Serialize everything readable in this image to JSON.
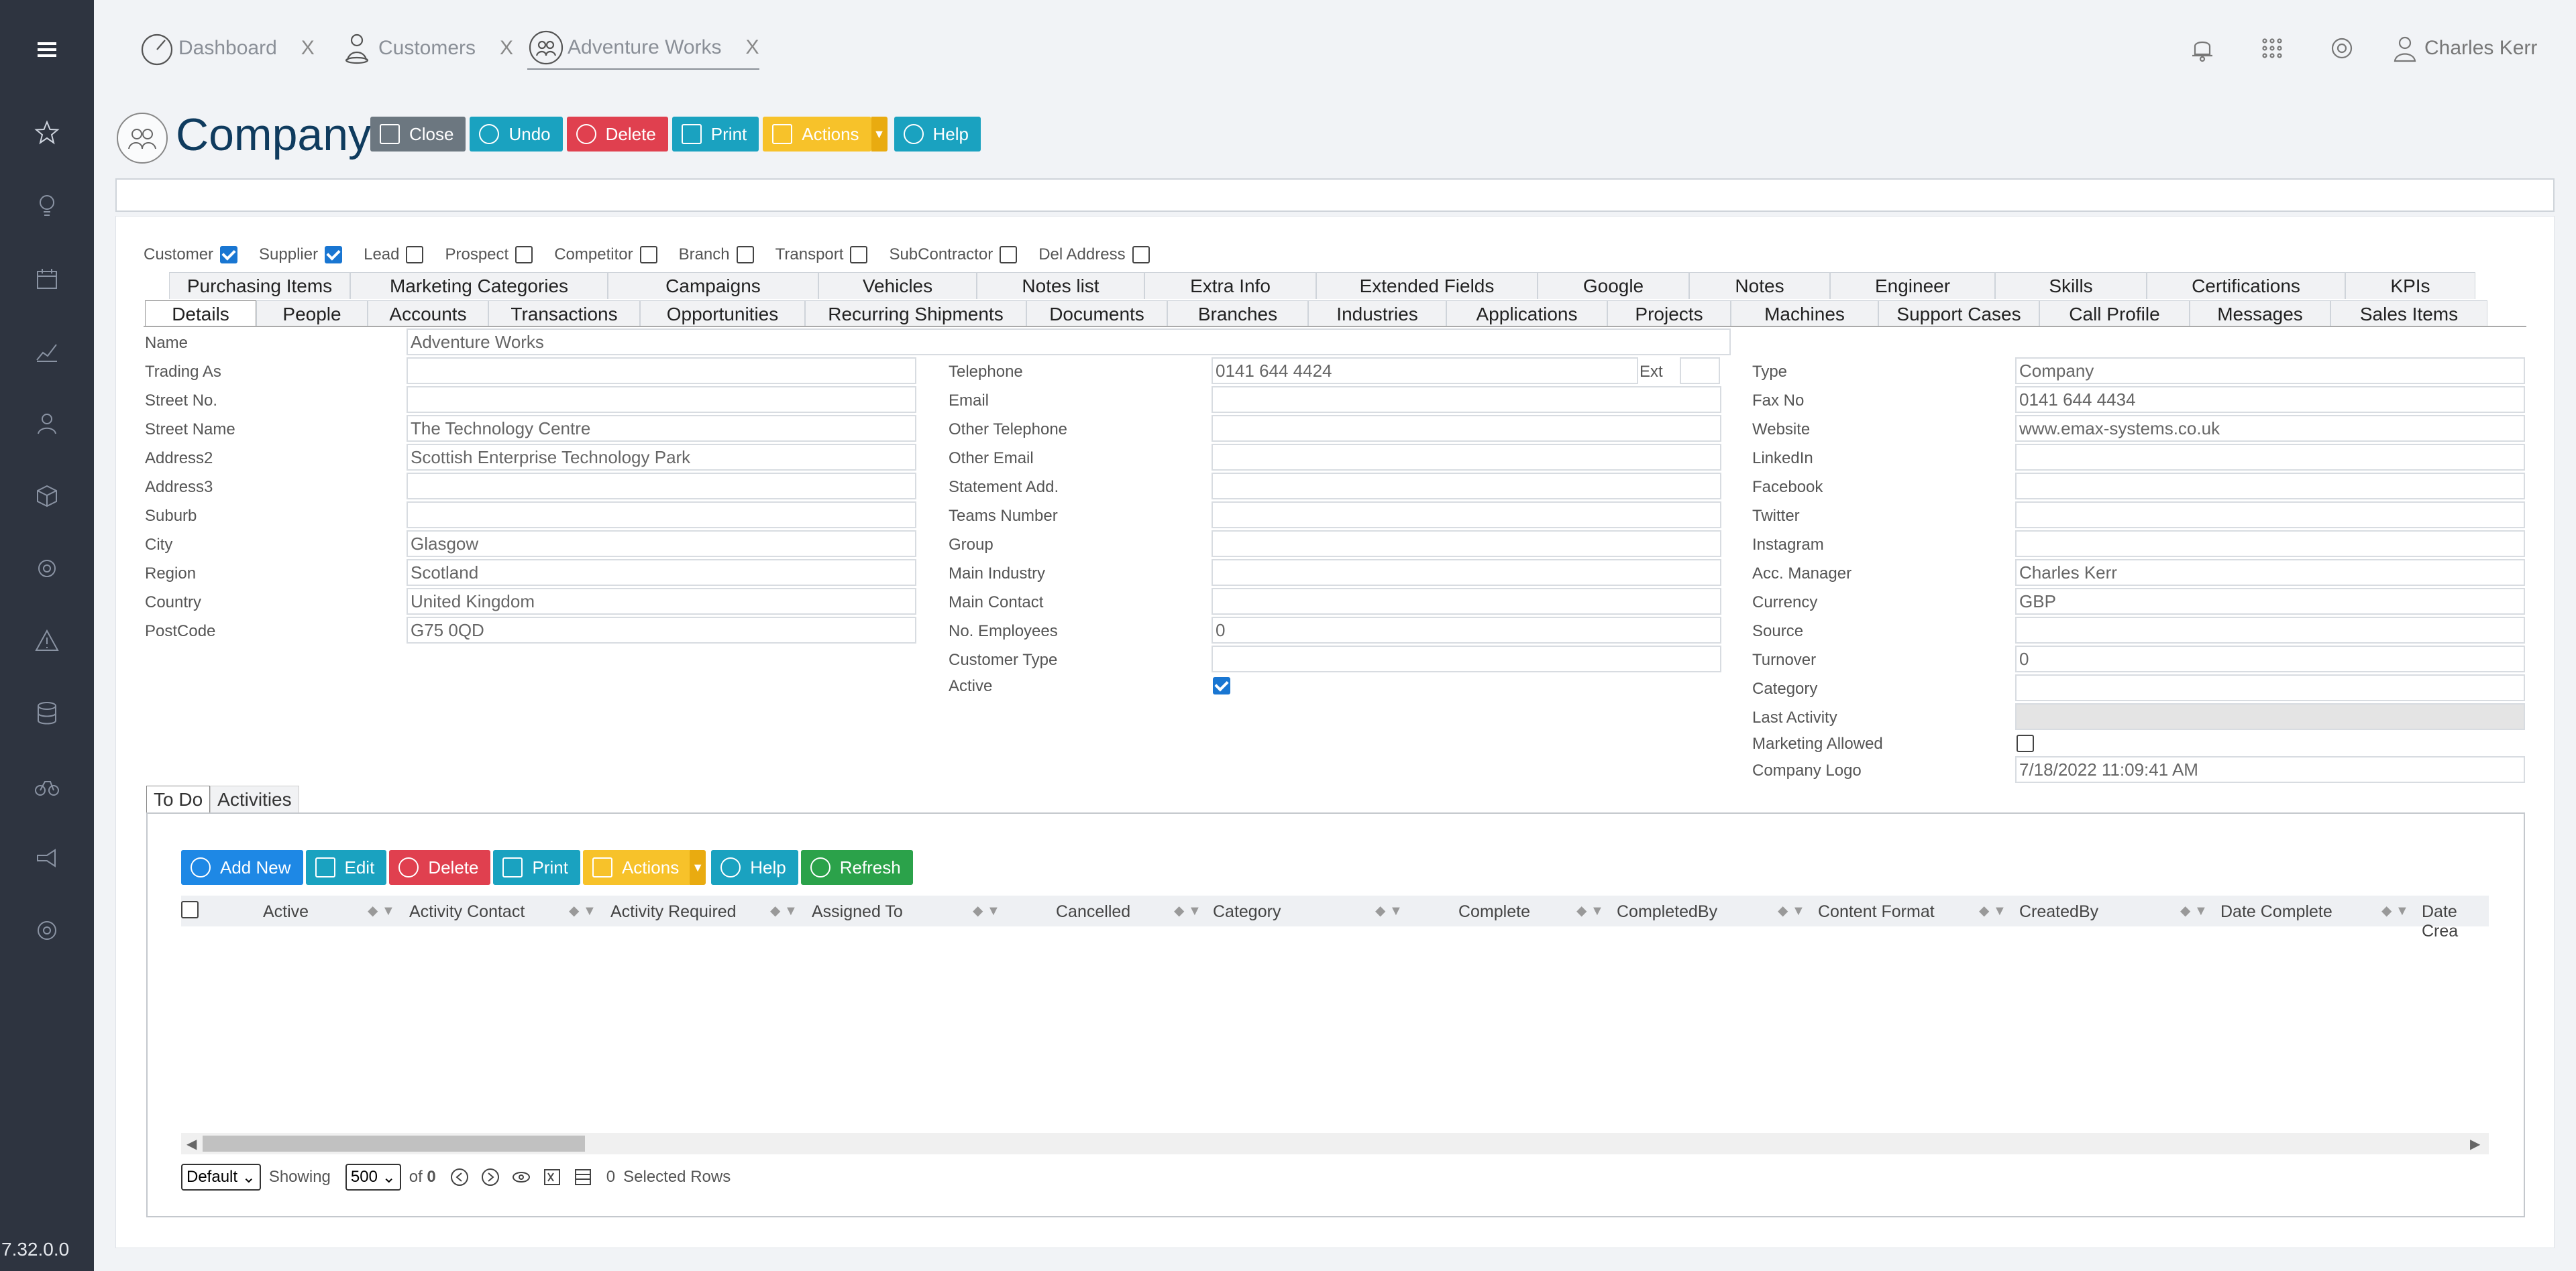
{
  "app": {
    "version": "7.32.0.0"
  },
  "tabs": [
    {
      "label": "Dashboard",
      "close": "X"
    },
    {
      "label": "Customers",
      "close": "X"
    },
    {
      "label": "Adventure Works",
      "close": "X"
    }
  ],
  "user": {
    "name": "Charles Kerr"
  },
  "page": {
    "title": "Company"
  },
  "toolbar": {
    "close": "Close",
    "undo": "Undo",
    "delete": "Delete",
    "print": "Print",
    "actions": "Actions",
    "help": "Help"
  },
  "flags": [
    {
      "label": "Customer",
      "checked": true
    },
    {
      "label": "Supplier",
      "checked": true
    },
    {
      "label": "Lead",
      "checked": false
    },
    {
      "label": "Prospect",
      "checked": false
    },
    {
      "label": "Competitor",
      "checked": false
    },
    {
      "label": "Branch",
      "checked": false
    },
    {
      "label": "Transport",
      "checked": false
    },
    {
      "label": "SubContractor",
      "checked": false
    },
    {
      "label": "Del Address",
      "checked": false
    }
  ],
  "tabs_row1": [
    "Purchasing Items",
    "Marketing Categories",
    "Campaigns",
    "Vehicles",
    "Notes list",
    "Extra Info",
    "Extended Fields",
    "Google",
    "Notes",
    "Engineer",
    "Skills",
    "Certifications",
    "KPIs"
  ],
  "tabs_row2": [
    "Details",
    "People",
    "Accounts",
    "Transactions",
    "Opportunities",
    "Recurring Shipments",
    "Documents",
    "Branches",
    "Industries",
    "Applications",
    "Projects",
    "Machines",
    "Support Cases",
    "Call Profile",
    "Messages",
    "Sales Items"
  ],
  "form": {
    "name_label": "Name",
    "name_value": "Adventure Works",
    "col1": [
      {
        "label": "Trading As",
        "value": ""
      },
      {
        "label": "Street No.",
        "value": ""
      },
      {
        "label": "Street Name",
        "value": "The Technology Centre"
      },
      {
        "label": "Address2",
        "value": "Scottish Enterprise Technology Park"
      },
      {
        "label": "Address3",
        "value": ""
      },
      {
        "label": "Suburb",
        "value": ""
      },
      {
        "label": "City",
        "value": "Glasgow"
      },
      {
        "label": "Region",
        "value": "Scotland"
      },
      {
        "label": "Country",
        "value": "United Kingdom"
      },
      {
        "label": "PostCode",
        "value": "G75 0QD"
      }
    ],
    "col2": [
      {
        "label": "Telephone",
        "value": "0141 644 4424"
      },
      {
        "label": "Email",
        "value": ""
      },
      {
        "label": "Other Telephone",
        "value": ""
      },
      {
        "label": "Other Email",
        "value": ""
      },
      {
        "label": "Statement Add.",
        "value": ""
      },
      {
        "label": "Teams Number",
        "value": ""
      },
      {
        "label": "Group",
        "value": ""
      },
      {
        "label": "Main Industry",
        "value": ""
      },
      {
        "label": "Main Contact",
        "value": ""
      },
      {
        "label": "No. Employees",
        "value": "0"
      },
      {
        "label": "Customer Type",
        "value": ""
      }
    ],
    "ext_label": "Ext",
    "active_label": "Active",
    "active_checked": true,
    "col3": [
      {
        "label": "Type",
        "value": "Company"
      },
      {
        "label": "Fax No",
        "value": "0141 644 4434"
      },
      {
        "label": "Website",
        "value": "www.emax-systems.co.uk"
      },
      {
        "label": "LinkedIn",
        "value": ""
      },
      {
        "label": "Facebook",
        "value": ""
      },
      {
        "label": "Twitter",
        "value": ""
      },
      {
        "label": "Instagram",
        "value": ""
      },
      {
        "label": "Acc. Manager",
        "value": "Charles Kerr"
      },
      {
        "label": "Currency",
        "value": "GBP"
      },
      {
        "label": "Source",
        "value": ""
      },
      {
        "label": "Turnover",
        "value": "0"
      },
      {
        "label": "Category",
        "value": ""
      },
      {
        "label": "Last Activity",
        "value": ""
      }
    ],
    "marketing_label": "Marketing Allowed",
    "marketing_checked": false,
    "logo_label": "Company Logo",
    "logo_value": "7/18/2022 11:09:41 AM"
  },
  "subtabs": [
    "To Do",
    "Activities"
  ],
  "grid_toolbar": {
    "add": "Add New",
    "edit": "Edit",
    "delete": "Delete",
    "print": "Print",
    "actions": "Actions",
    "help": "Help",
    "refresh": "Refresh"
  },
  "grid_columns": [
    "Active",
    "Activity Contact",
    "Activity Required",
    "Assigned To",
    "Cancelled",
    "Category",
    "Complete",
    "CompletedBy",
    "Content Format",
    "CreatedBy",
    "Date Complete",
    "Date Crea"
  ],
  "pager": {
    "view": "Default",
    "showing": "Showing",
    "page_size": "500",
    "of": "of",
    "total": "0",
    "selected_count": "0",
    "selected_label": "Selected Rows"
  },
  "colors": {
    "sidebar": "#2e3440",
    "title": "#0f3b5e",
    "teal": "#1aa2c0",
    "red": "#e0404f",
    "yellow": "#f7c22a",
    "green": "#2ba24a",
    "blue": "#1e88e5"
  }
}
